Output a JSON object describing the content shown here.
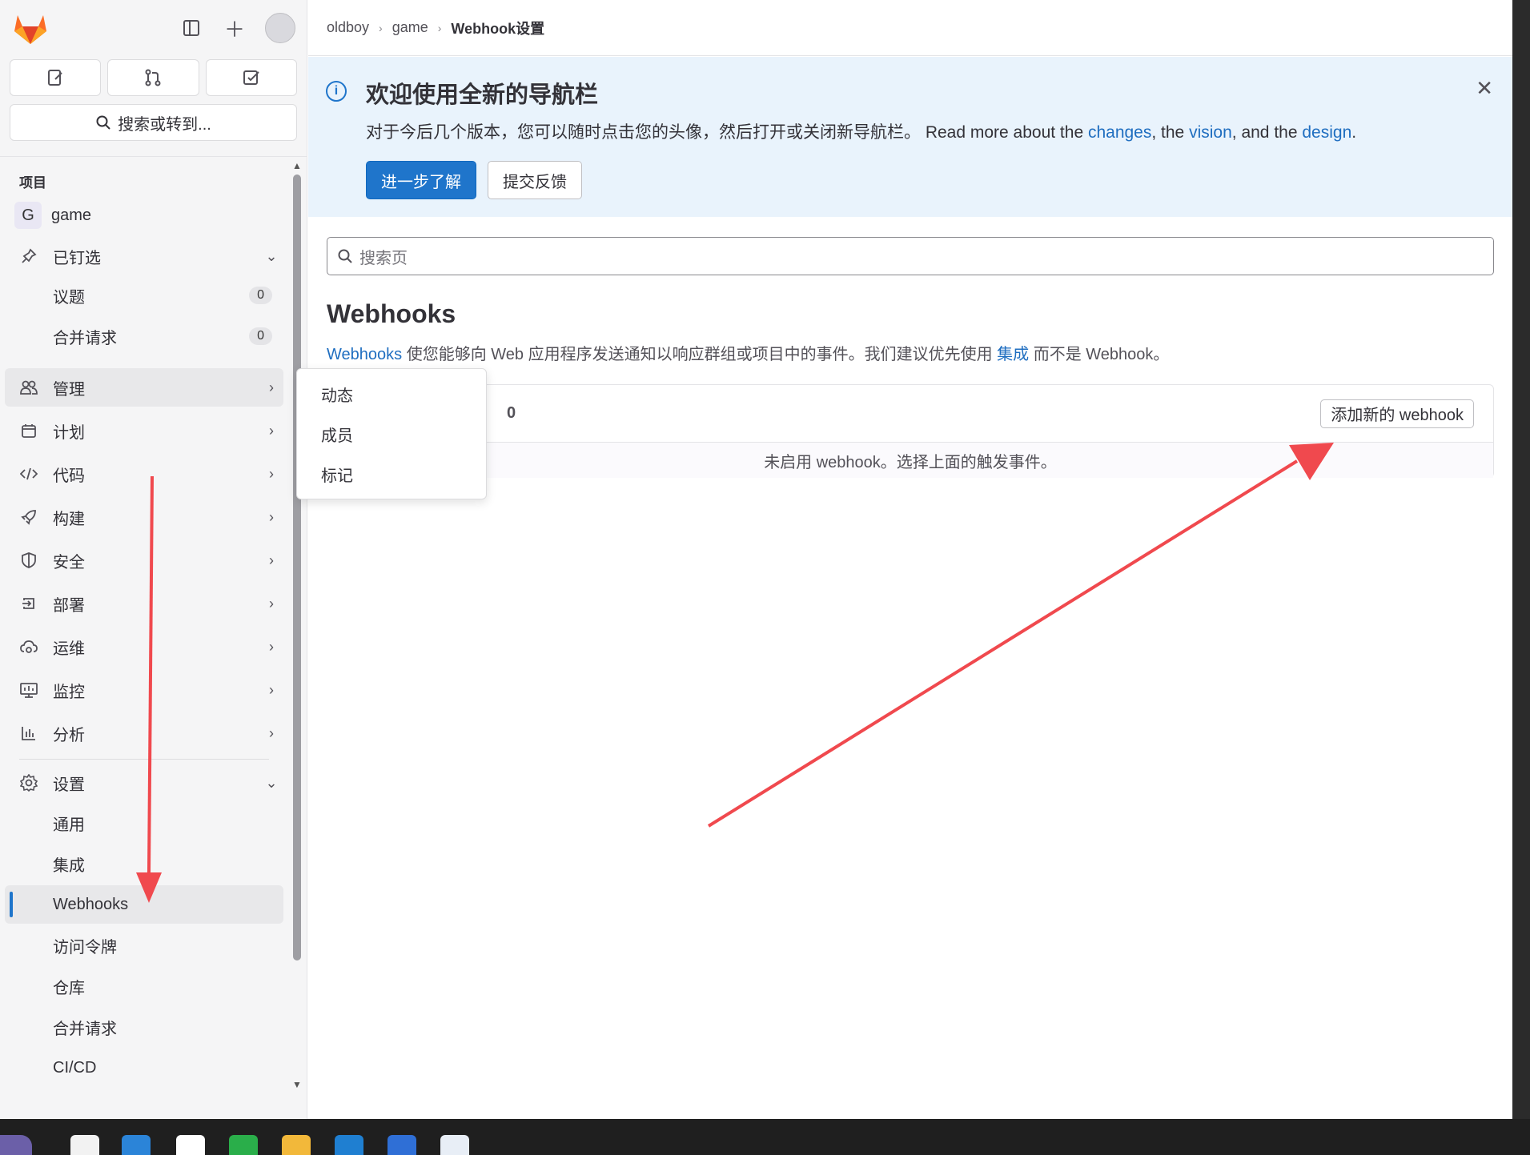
{
  "sidebar": {
    "search_label": "搜索或转到...",
    "section_label": "项目",
    "project": {
      "initial": "G",
      "name": "game"
    },
    "pinned": {
      "label": "已钉选",
      "items": [
        {
          "label": "议题",
          "count": "0"
        },
        {
          "label": "合并请求",
          "count": "0"
        }
      ]
    },
    "nav": [
      {
        "label": "管理"
      },
      {
        "label": "计划"
      },
      {
        "label": "代码"
      },
      {
        "label": "构建"
      },
      {
        "label": "安全"
      },
      {
        "label": "部署"
      },
      {
        "label": "运维"
      },
      {
        "label": "监控"
      },
      {
        "label": "分析"
      }
    ],
    "settings": {
      "label": "设置",
      "items": [
        {
          "label": "通用"
        },
        {
          "label": "集成"
        },
        {
          "label": "Webhooks"
        },
        {
          "label": "访问令牌"
        },
        {
          "label": "仓库"
        },
        {
          "label": "合并请求"
        },
        {
          "label": "CI/CD"
        }
      ]
    }
  },
  "flyout": {
    "items": [
      "动态",
      "成员",
      "标记"
    ]
  },
  "breadcrumb": {
    "items": [
      "oldboy",
      "game"
    ],
    "current": "Webhook设置"
  },
  "banner": {
    "title": "欢迎使用全新的导航栏",
    "desc_prefix": "对于今后几个版本，您可以随时点击您的头像，然后打开或关闭新导航栏。 Read more about the ",
    "link1": "changes",
    "sep1": ", the ",
    "link2": "vision",
    "sep2": ", and the ",
    "link3": "design",
    "end": ".",
    "primary_btn": "进一步了解",
    "secondary_btn": "提交反馈"
  },
  "main": {
    "search_placeholder": "搜索页",
    "title": "Webhooks",
    "desc_link": "Webhooks",
    "desc_mid": " 使您能够向 Web 应用程序发送通知以响应群组或项目中的事件。我们建议优先使用 ",
    "desc_link2": "集成",
    "desc_end": " 而不是 Webhook。",
    "card_count": "0",
    "add_button": "添加新的 webhook",
    "empty_text": "未启用 webhook。选择上面的触发事件。"
  },
  "colors": {
    "accent": "#1f75cb",
    "annotation": "#f0494e"
  }
}
